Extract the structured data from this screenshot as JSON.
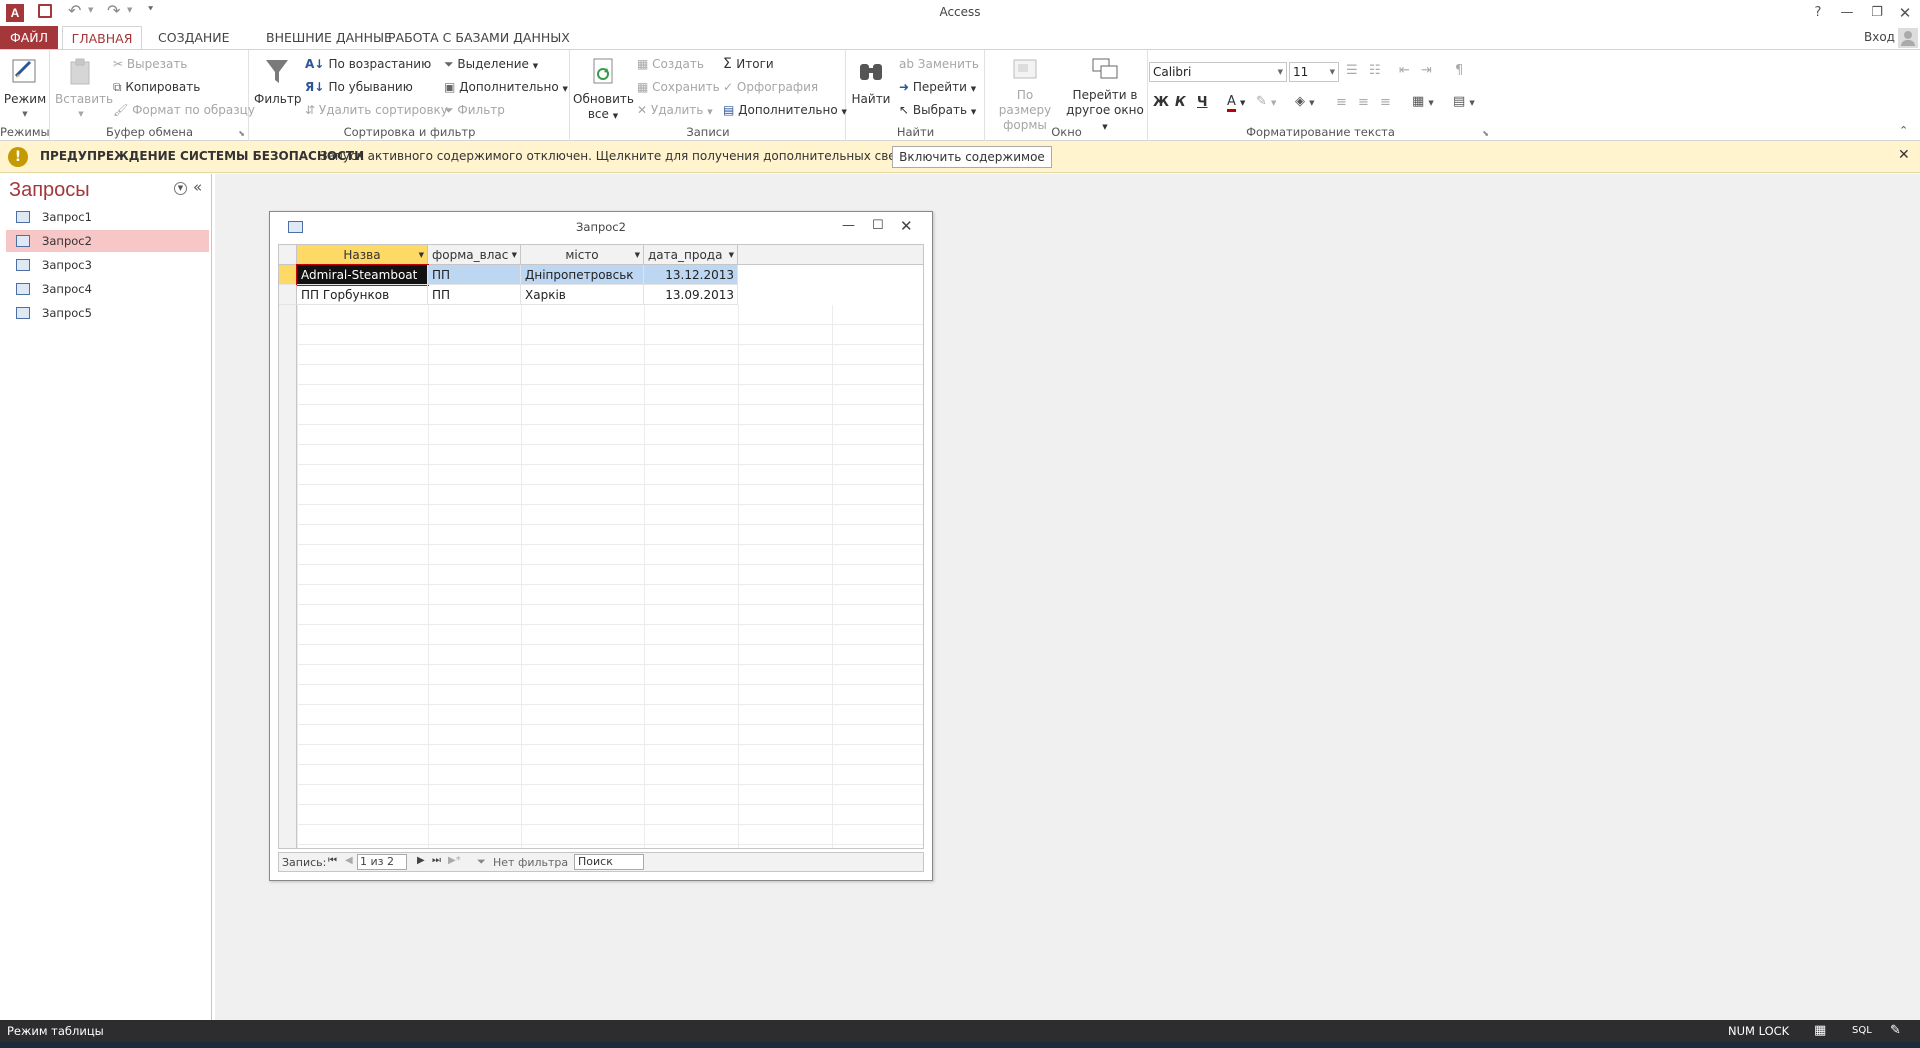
{
  "window": {
    "app_title": "Access",
    "help": "?",
    "signin": "Вход"
  },
  "tabs": [
    {
      "label": "ФАЙЛ"
    },
    {
      "label": "ГЛАВНАЯ"
    },
    {
      "label": "СОЗДАНИЕ"
    },
    {
      "label": "ВНЕШНИЕ ДАННЫЕ"
    },
    {
      "label": "РАБОТА С БАЗАМИ ДАННЫХ"
    }
  ],
  "ribbon": {
    "views": {
      "label": "Режимы",
      "mode": "Режим"
    },
    "clipboard": {
      "label": "Буфер обмена",
      "paste": "Вставить",
      "cut": "Вырезать",
      "copy": "Копировать",
      "format_painter": "Формат по образцу"
    },
    "sort_filter": {
      "label": "Сортировка и фильтр",
      "filter": "Фильтр",
      "ascending": "По возрастанию",
      "descending": "По убыванию",
      "remove_sort": "Удалить сортировку",
      "selection": "Выделение",
      "advanced": "Дополнительно",
      "toggle_filter": "Фильтр"
    },
    "records": {
      "label": "Записи",
      "refresh_1": "Обновить",
      "refresh_2": "все",
      "new": "Создать",
      "save": "Сохранить",
      "delete": "Удалить",
      "totals": "Итоги",
      "spelling": "Орфография",
      "more": "Дополнительно"
    },
    "find": {
      "label": "Найти",
      "find": "Найти",
      "replace": "Заменить",
      "goto": "Перейти",
      "select": "Выбрать"
    },
    "window": {
      "label": "Окно",
      "size_fit_1": "По размеру",
      "size_fit_2": "формы",
      "switch_1": "Перейти в",
      "switch_2": "другое окно"
    },
    "text_format": {
      "label": "Форматирование текста",
      "font": "Calibri",
      "size": "11",
      "bold": "Ж",
      "italic": "К",
      "underline": "Ч"
    }
  },
  "warning": {
    "title": "ПРЕДУПРЕЖДЕНИЕ СИСТЕМЫ БЕЗОПАСНОСТИ",
    "message": "Запуск активного содержимого отключен. Щелкните для получения дополнительных сведений.",
    "button": "Включить содержимое"
  },
  "nav": {
    "title": "Запросы",
    "items": [
      {
        "label": "Запрос1"
      },
      {
        "label": "Запрос2"
      },
      {
        "label": "Запрос3"
      },
      {
        "label": "Запрос4"
      },
      {
        "label": "Запрос5"
      }
    ]
  },
  "child": {
    "title": "Запрос2",
    "columns": [
      "Назва",
      "форма_влас",
      "місто",
      "дата_прода"
    ],
    "rows": [
      [
        "Admiral-Steamboat",
        "ПП",
        "Дніпропетровськ",
        "13.12.2013"
      ],
      [
        "ПП Горбунков",
        "ПП",
        "Харків",
        "13.09.2013"
      ]
    ],
    "navbar": {
      "record_label": "Запись:",
      "position": "1 из 2",
      "filter": "Нет фильтра",
      "search": "Поиск"
    }
  },
  "status": {
    "left": "Режим таблицы",
    "numlock": "NUM LOCK",
    "sql": "SQL"
  },
  "colors": {
    "accent": "#a4373a",
    "selected_nav": "#f7c6c7",
    "warning_bg": "#fff4ce",
    "header_active": "#ffd966",
    "selected_cell": "#bdd7f3"
  }
}
